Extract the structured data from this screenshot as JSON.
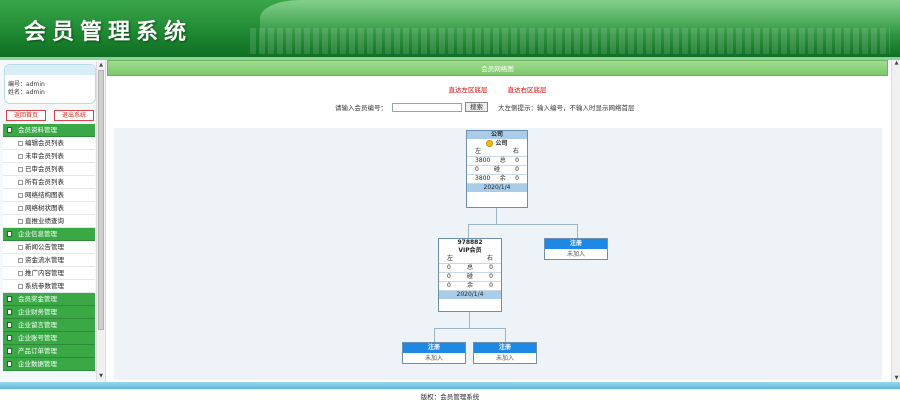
{
  "app": {
    "title": "会员管理系统"
  },
  "user": {
    "account_line": "编号：admin",
    "name_line": "姓名：admin"
  },
  "sidebar": {
    "home_button": "返回首页",
    "logout_button": "退出系统",
    "groups": [
      {
        "label": "会员资料管理",
        "items": [
          "编辑会员列表",
          "未审会员列表",
          "已审会员列表",
          "所有会员列表",
          "网络结构图表",
          "网络树状图表",
          "直推业绩查询"
        ]
      },
      {
        "label": "企业信息管理",
        "items": [
          "新闻公告管理",
          "资金流水管理",
          "推广内容管理",
          "系统参数管理"
        ]
      },
      {
        "label": "会员奖金管理",
        "items": []
      },
      {
        "label": "企业财务管理",
        "items": []
      },
      {
        "label": "企业留言管理",
        "items": []
      },
      {
        "label": "企业账号管理",
        "items": []
      },
      {
        "label": "产品订单管理",
        "items": []
      },
      {
        "label": "企业数据管理",
        "items": []
      }
    ]
  },
  "main": {
    "title": "会员网络图",
    "link_left": "直达左区底层",
    "link_right": "直达右区底层",
    "search_label": "请输入会员编号：",
    "search_value": "",
    "search_button": "搜索",
    "hint": "大左侧提示：输入编号，不输入时显示网络首层"
  },
  "tree": {
    "root": {
      "id": "公司",
      "rank": "公司",
      "header": [
        "左",
        "",
        "右"
      ],
      "rows": [
        [
          "3800",
          "总",
          "0"
        ],
        [
          "0",
          "碰",
          "0"
        ],
        [
          "3800",
          "余",
          "0"
        ]
      ],
      "date": "2020/1/4"
    },
    "child": {
      "id": "978882",
      "rank": "VIP会员",
      "header": [
        "左",
        "",
        "右"
      ],
      "rows": [
        [
          "0",
          "总",
          "0"
        ],
        [
          "0",
          "碰",
          "0"
        ],
        [
          "0",
          "余",
          "0"
        ]
      ],
      "date": "2020/1/4"
    },
    "empty_label": "注册",
    "empty_status": "未加入"
  },
  "footer": {
    "text": "版权：会员管理系统"
  }
}
